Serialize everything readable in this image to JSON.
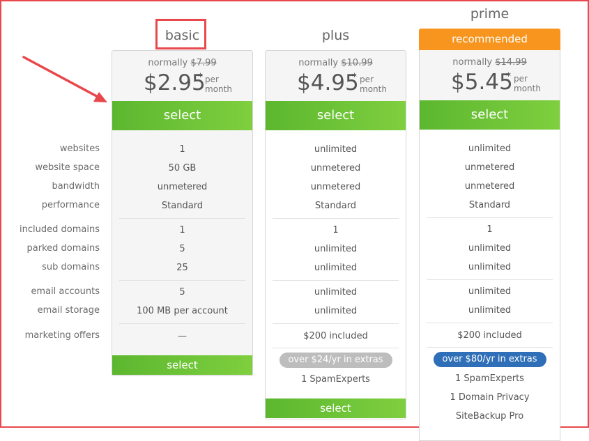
{
  "features": {
    "websites": "websites",
    "website_space": "website space",
    "bandwidth": "bandwidth",
    "performance": "performance",
    "included_domains": "included domains",
    "parked_domains": "parked domains",
    "sub_domains": "sub domains",
    "email_accounts": "email accounts",
    "email_storage": "email storage",
    "marketing_offers": "marketing offers"
  },
  "recommended_label": "recommended",
  "plans": {
    "basic": {
      "name": "basic",
      "normally_label": "normally",
      "old_price": "$7.99",
      "price": "$2.95",
      "asterisk": "*",
      "per": "per",
      "month": "month",
      "select_label": "select",
      "websites": "1",
      "website_space": "50 GB",
      "bandwidth": "unmetered",
      "performance": "Standard",
      "included_domains": "1",
      "parked_domains": "5",
      "sub_domains": "25",
      "email_accounts": "5",
      "email_storage": "100 MB per account",
      "marketing_offers": "—",
      "bottom_select_label": "select"
    },
    "plus": {
      "name": "plus",
      "normally_label": "normally",
      "old_price": "$10.99",
      "price": "$4.95",
      "asterisk": "*",
      "per": "per",
      "month": "month",
      "select_label": "select",
      "websites": "unlimited",
      "website_space": "unmetered",
      "bandwidth": "unmetered",
      "performance": "Standard",
      "included_domains": "1",
      "parked_domains": "unlimited",
      "sub_domains": "unlimited",
      "email_accounts": "unlimited",
      "email_storage": "unlimited",
      "marketing_offers": "$200 included",
      "extras_pill": "over $24/yr in extras",
      "extra_1": "1 SpamExperts",
      "bottom_select_label": "select"
    },
    "prime": {
      "name": "prime",
      "normally_label": "normally",
      "old_price": "$14.99",
      "price": "$5.45",
      "asterisk": "*",
      "per": "per",
      "month": "month",
      "select_label": "select",
      "websites": "unlimited",
      "website_space": "unmetered",
      "bandwidth": "unmetered",
      "performance": "Standard",
      "included_domains": "1",
      "parked_domains": "unlimited",
      "sub_domains": "unlimited",
      "email_accounts": "unlimited",
      "email_storage": "unlimited",
      "marketing_offers": "$200 included",
      "extras_pill": "over $80/yr in extras",
      "extra_1": "1 SpamExperts",
      "extra_2": "1 Domain Privacy",
      "extra_3": "SiteBackup Pro"
    }
  },
  "colors": {
    "green": "#6cc235",
    "orange": "#f7951e",
    "annotation_red": "#e8474b",
    "pill_grey": "#bdbdbd",
    "pill_blue": "#2f6fb8"
  }
}
